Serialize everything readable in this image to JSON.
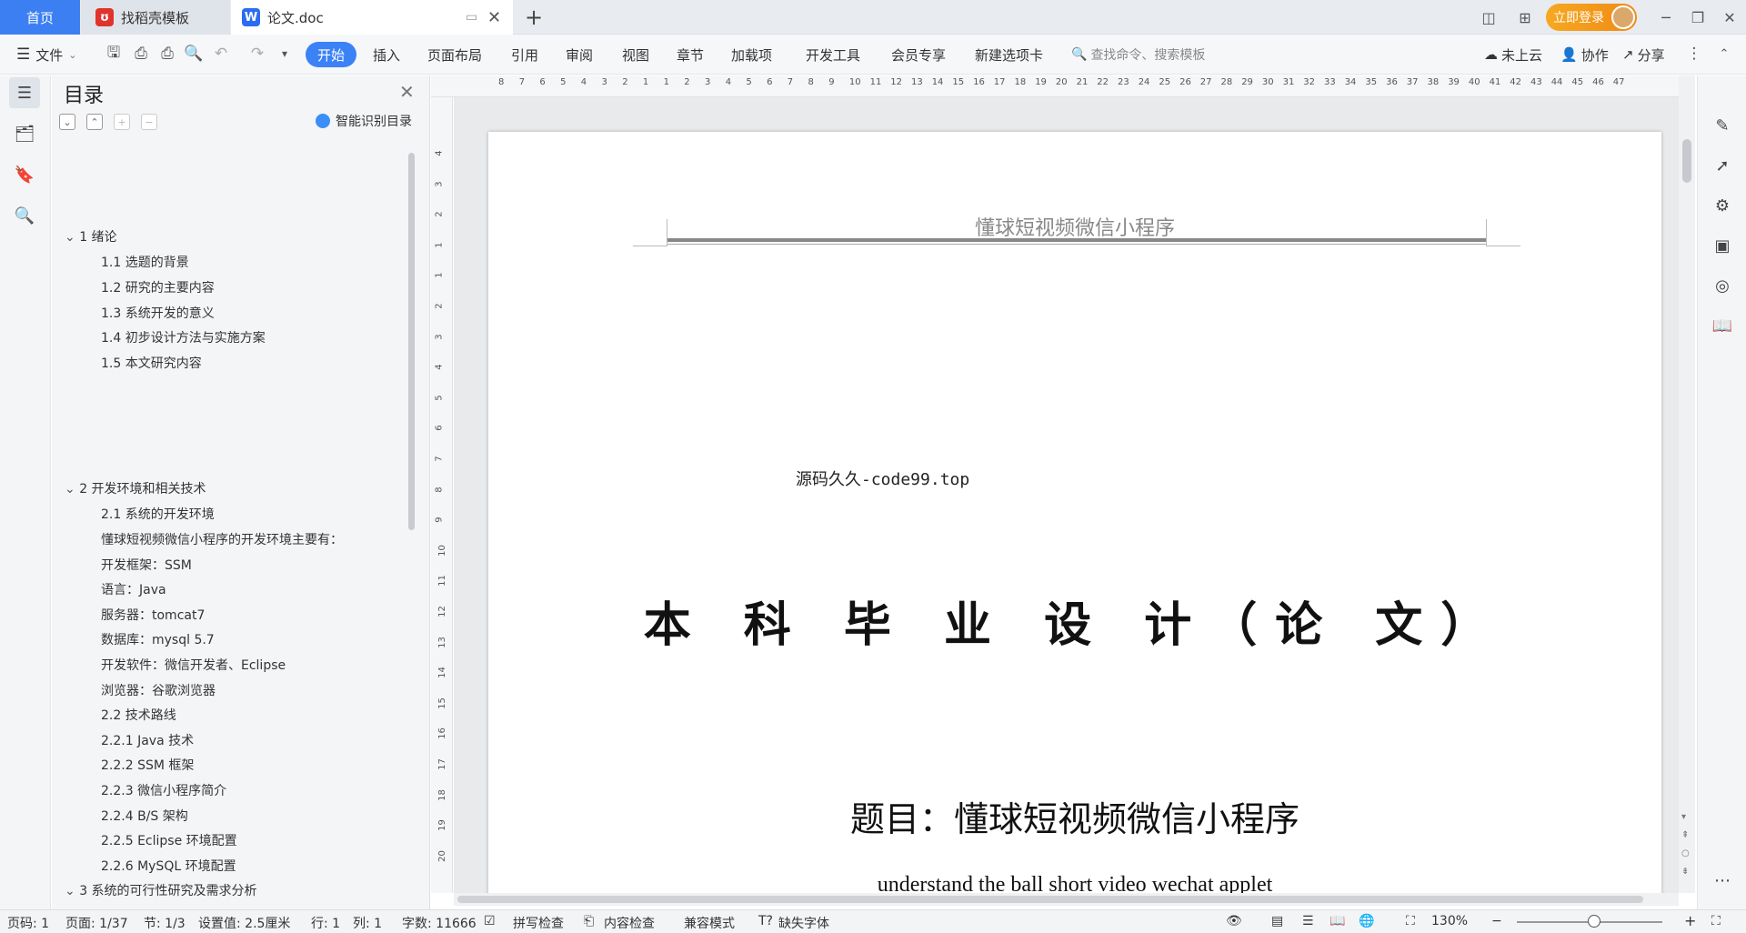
{
  "tabs": {
    "home": "首页",
    "daoke": "找稻壳模板",
    "doc": "论文.doc"
  },
  "header_right": {
    "login": "立即登录"
  },
  "toolbar": {
    "file": "文件",
    "menus": [
      "开始",
      "插入",
      "页面布局",
      "引用",
      "审阅",
      "视图",
      "章节",
      "加载项",
      "开发工具",
      "会员专享",
      "新建选项卡"
    ],
    "search_placeholder": "查找命令、搜索模板",
    "cloud": "未上云",
    "collab": "协作",
    "share": "分享"
  },
  "toc": {
    "title": "目录",
    "ai_label": "智能识别目录",
    "entries": [
      {
        "text": "1  绪论",
        "level": 1
      },
      {
        "text": "1.1 选题的背景",
        "level": 2
      },
      {
        "text": "1.2  研究的主要内容",
        "level": 2
      },
      {
        "text": "1.3  系统开发的意义",
        "level": 2
      },
      {
        "text": "1.4 初步设计方法与实施方案",
        "level": 2
      },
      {
        "text": "1.5  本文研究内容",
        "level": 2
      },
      {
        "text": "2  开发环境和相关技术",
        "level": 1
      },
      {
        "text": "2.1 系统的开发环境",
        "level": 2
      },
      {
        "text": "懂球短视频微信小程序的开发环境主要有：",
        "level": 2
      },
      {
        "text": "开发框架：SSM",
        "level": 2
      },
      {
        "text": "语言：Java",
        "level": 2
      },
      {
        "text": "服务器：tomcat7",
        "level": 2
      },
      {
        "text": "数据库：mysql 5.7",
        "level": 2
      },
      {
        "text": "开发软件：微信开发者、Eclipse",
        "level": 2
      },
      {
        "text": "浏览器：谷歌浏览器",
        "level": 2
      },
      {
        "text": "2.2 技术路线",
        "level": 2
      },
      {
        "text": "2.2.1 Java 技术",
        "level": 2
      },
      {
        "text": "2.2.2 SSM 框架",
        "level": 2
      },
      {
        "text": "2.2.3 微信小程序简介",
        "level": 2
      },
      {
        "text": "2.2.4 B/S 架构",
        "level": 2
      },
      {
        "text": "2.2.5 Eclipse 环境配置",
        "level": 2
      },
      {
        "text": "2.2.6 MySQL 环境配置",
        "level": 2
      },
      {
        "text": "3 系统的可行性研究及需求分析",
        "level": 1
      }
    ]
  },
  "ruler": {
    "top_numbers": [
      "8",
      "7",
      "6",
      "5",
      "4",
      "3",
      "2",
      "1",
      "1",
      "2",
      "3",
      "4",
      "5",
      "6",
      "7",
      "8",
      "9",
      "10",
      "11",
      "12",
      "13",
      "14",
      "15",
      "16",
      "17",
      "18",
      "19",
      "20",
      "21",
      "22",
      "23",
      "24",
      "25",
      "26",
      "27",
      "28",
      "29",
      "30",
      "31",
      "32",
      "33",
      "34",
      "35",
      "36",
      "37",
      "38",
      "39",
      "40",
      "41",
      "42",
      "43",
      "44",
      "45",
      "46",
      "47"
    ],
    "left_numbers": [
      "4",
      "3",
      "2",
      "1",
      "1",
      "2",
      "3",
      "4",
      "5",
      "6",
      "7",
      "8",
      "9",
      "10",
      "11",
      "12",
      "13",
      "14",
      "15",
      "16",
      "17",
      "18",
      "19",
      "20"
    ]
  },
  "document": {
    "header": "懂球短视频微信小程序",
    "source": "源码久久-code99.top",
    "title": "本 科 毕 业 设 计（论 文）",
    "subject": "题目：懂球短视频微信小程序",
    "english_title": "understand the ball short video wechat applet"
  },
  "status": {
    "page_code": "页码: 1",
    "page": "页面: 1/37",
    "section": "节: 1/3",
    "setting": "设置值: 2.5厘米",
    "row": "行: 1",
    "col": "列: 1",
    "wordcount": "字数: 11666",
    "spell": "拼写检查",
    "content_check": "内容检查",
    "compat": "兼容模式",
    "missing_font": "缺失字体",
    "zoom": "130%",
    "zoom_level": 0.53
  }
}
